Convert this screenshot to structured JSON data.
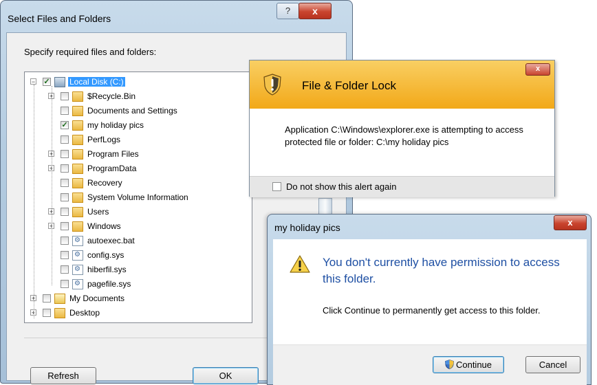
{
  "select_window": {
    "title": "Select Files and Folders",
    "help_label": "?",
    "close_label": "x",
    "prompt": "Specify required files and folders:",
    "refresh_label": "Refresh",
    "ok_label": "OK",
    "tree": {
      "root": {
        "label": "Local Disk (C:)",
        "checked": true,
        "icon": "drive-icon"
      },
      "items": [
        {
          "label": "$Recycle.Bin",
          "checked": false,
          "expandable": true,
          "icon": "folder-icon"
        },
        {
          "label": "Documents and Settings",
          "checked": false,
          "expandable": false,
          "icon": "folder-icon"
        },
        {
          "label": "my holiday pics",
          "checked": true,
          "expandable": false,
          "icon": "folder-icon"
        },
        {
          "label": "PerfLogs",
          "checked": false,
          "expandable": false,
          "icon": "folder-icon"
        },
        {
          "label": "Program Files",
          "checked": false,
          "expandable": true,
          "icon": "folder-icon"
        },
        {
          "label": "ProgramData",
          "checked": false,
          "expandable": true,
          "icon": "folder-icon"
        },
        {
          "label": "Recovery",
          "checked": false,
          "expandable": false,
          "icon": "folder-icon"
        },
        {
          "label": "System Volume Information",
          "checked": false,
          "expandable": false,
          "icon": "folder-icon"
        },
        {
          "label": "Users",
          "checked": false,
          "expandable": true,
          "icon": "folder-icon"
        },
        {
          "label": "Windows",
          "checked": false,
          "expandable": true,
          "icon": "folder-icon"
        },
        {
          "label": "autoexec.bat",
          "checked": false,
          "expandable": false,
          "icon": "system-file-icon"
        },
        {
          "label": "config.sys",
          "checked": false,
          "expandable": false,
          "icon": "system-file-icon"
        },
        {
          "label": "hiberfil.sys",
          "checked": false,
          "expandable": false,
          "icon": "system-file-icon"
        },
        {
          "label": "pagefile.sys",
          "checked": false,
          "expandable": false,
          "icon": "system-file-icon"
        }
      ],
      "siblings": [
        {
          "label": "My Documents",
          "checked": false,
          "expandable": true,
          "icon": "documents-folder-icon"
        },
        {
          "label": "Desktop",
          "checked": false,
          "expandable": true,
          "icon": "folder-icon"
        }
      ]
    }
  },
  "lock_alert": {
    "title": "File & Folder Lock",
    "close_label": "x",
    "message": "Application C:\\Windows\\explorer.exe is attempting to access protected file or folder: C:\\my holiday pics",
    "checkbox_label": "Do not show this alert again",
    "checkbox_checked": false,
    "header_color": "#f5b323"
  },
  "permission_dialog": {
    "title": "my holiday pics",
    "close_label": "x",
    "heading": "You don't currently have permission to access this folder.",
    "message": "Click Continue to permanently get access to this folder.",
    "continue_label": "Continue",
    "cancel_label": "Cancel",
    "heading_color": "#1e4fa3"
  }
}
